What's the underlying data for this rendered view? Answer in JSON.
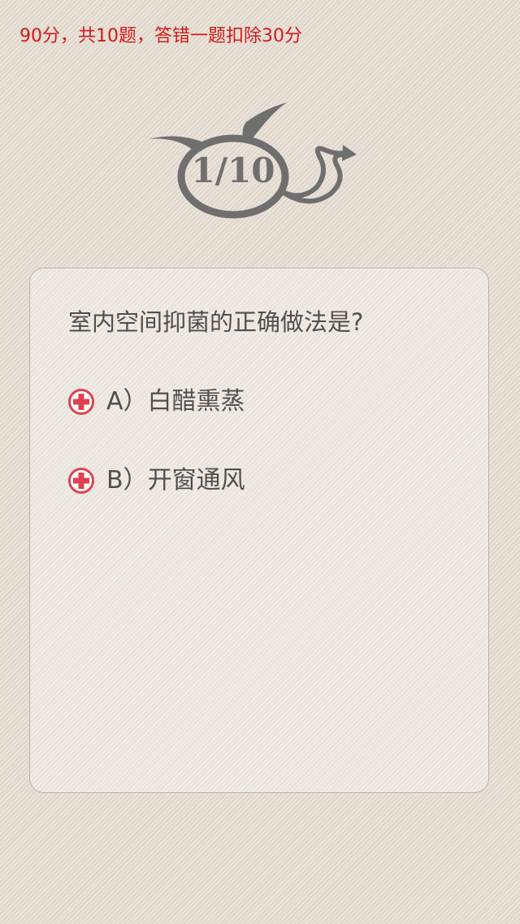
{
  "header": {
    "score_text": "90分，共10题，答错一题扣除30分"
  },
  "progress": {
    "text": "1/10",
    "current": 1,
    "total": 10
  },
  "quiz": {
    "question": "室内空间抑菌的正确做法是?",
    "options": [
      {
        "label": "A）白醋熏蒸"
      },
      {
        "label": "B）开窗通风"
      }
    ]
  },
  "colors": {
    "score_text": "#d31a1a",
    "option_icon": "#e0414f",
    "badge": "#6f6f6f",
    "background": "#e6ded2",
    "card": "#ece7df"
  },
  "icons": {
    "badge": "devil-bubble-icon",
    "option": "plus-circle-icon"
  }
}
